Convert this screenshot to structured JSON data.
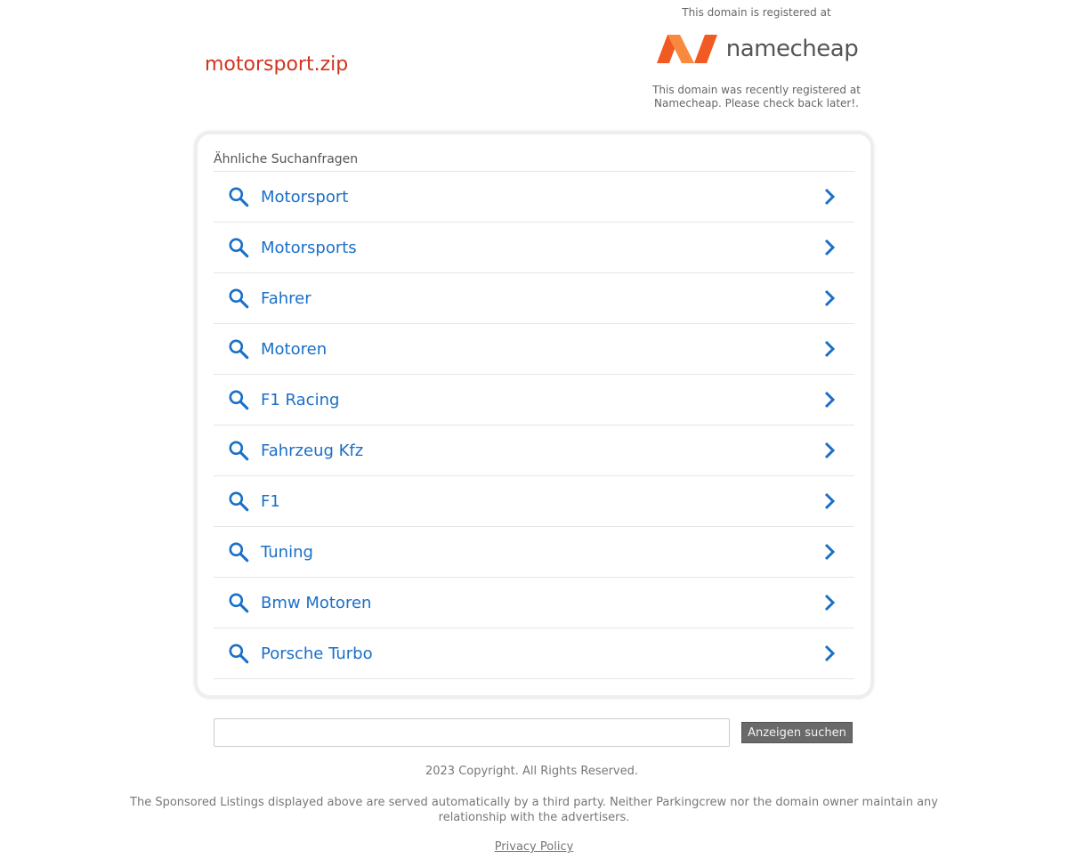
{
  "domain": "motorsport.zip",
  "registrar": {
    "registered_at": "This domain is registered at",
    "logo_text": "namecheap",
    "note_line1": "This domain was recently registered at",
    "note_line2": "Namecheap. Please check back later!."
  },
  "related": {
    "heading": "Ähnliche Suchanfragen",
    "items": [
      {
        "label": "Motorsport"
      },
      {
        "label": "Motorsports"
      },
      {
        "label": "Fahrer"
      },
      {
        "label": "Motoren"
      },
      {
        "label": "F1 Racing"
      },
      {
        "label": "Fahrzeug Kfz"
      },
      {
        "label": "F1"
      },
      {
        "label": "Tuning"
      },
      {
        "label": "Bmw Motoren"
      },
      {
        "label": "Porsche Turbo"
      }
    ]
  },
  "search": {
    "value": "",
    "button_label": "Anzeigen suchen"
  },
  "footer": {
    "copyright": "2023 Copyright. All Rights Reserved.",
    "disclaimer": "The Sponsored Listings displayed above are served automatically by a third party. Neither Parkingcrew nor the domain owner maintain any relationship with the advertisers.",
    "privacy": "Privacy Policy"
  },
  "colors": {
    "domain_title": "#d0341f",
    "link_blue": "#1a6fc7",
    "logo_orange": "#f15a22",
    "button_bg": "#6a6a6a"
  },
  "icons": {
    "row_left": "search-icon",
    "row_right": "chevron-right-icon"
  }
}
